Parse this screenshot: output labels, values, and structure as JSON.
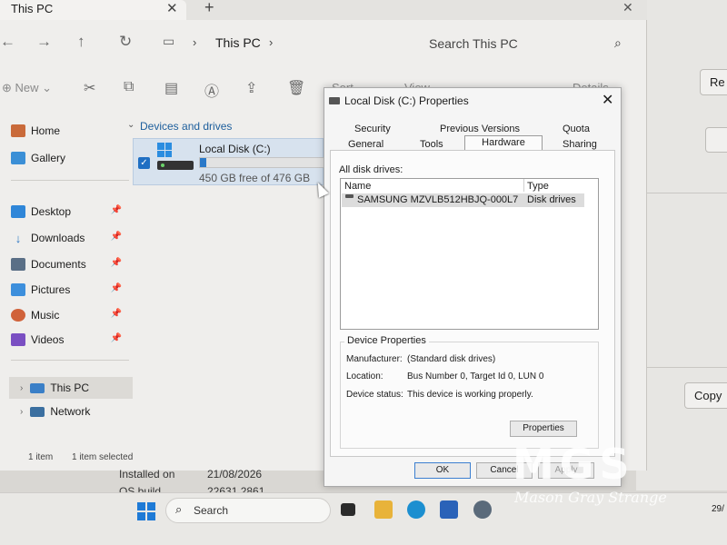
{
  "explorer": {
    "tab_title": "This PC",
    "breadcrumb": "This PC",
    "search_placeholder": "Search This PC",
    "toolbar": {
      "new_label": "New",
      "sort_label": "Sort",
      "view_label": "View",
      "details_label": "Details"
    },
    "sidebar": {
      "home": "Home",
      "gallery": "Gallery",
      "pinned": [
        {
          "label": "Desktop"
        },
        {
          "label": "Downloads"
        },
        {
          "label": "Documents"
        },
        {
          "label": "Pictures"
        },
        {
          "label": "Music"
        },
        {
          "label": "Videos"
        }
      ],
      "this_pc": "This PC",
      "network": "Network"
    },
    "content": {
      "group_header": "Devices and drives",
      "drive_name": "Local Disk (C:)",
      "drive_free": "450 GB free of 476 GB",
      "drive_used_fraction": 0.055
    },
    "status": {
      "item_count": "1 item",
      "selected": "1 item selected"
    },
    "behind_text": {
      "installed_on_label": "Installed on",
      "installed_on_value": "21/08/2026",
      "os_build_label": "OS build",
      "os_build_value": "22631.2861"
    }
  },
  "background_window": {
    "btn_top": "Re",
    "btn_copy": "Copy"
  },
  "dialog": {
    "title": "Local Disk (C:) Properties",
    "tabs_row1": {
      "security": "Security",
      "previous_versions": "Previous Versions",
      "quota": "Quota"
    },
    "tabs_row2": {
      "general": "General",
      "tools": "Tools",
      "hardware": "Hardware",
      "sharing": "Sharing"
    },
    "all_disk_drives_label": "All disk drives:",
    "columns": {
      "name": "Name",
      "type": "Type"
    },
    "drive_row": {
      "name": "SAMSUNG MZVLB512HBJQ-000L7",
      "type": "Disk drives"
    },
    "device_properties": {
      "group_label": "Device Properties",
      "manufacturer_label": "Manufacturer:",
      "manufacturer_value": "(Standard disk drives)",
      "location_label": "Location:",
      "location_value": "Bus Number 0, Target Id 0, LUN 0",
      "status_label": "Device status:",
      "status_value": "This device is working properly.",
      "properties_button": "Properties"
    },
    "buttons": {
      "ok": "OK",
      "cancel": "Cancel",
      "apply": "Apply"
    }
  },
  "taskbar": {
    "search_label": "Search",
    "clock": "29/"
  },
  "colors": {
    "accent": "#1f6fc3",
    "selection_bg": "#d7e2ee",
    "link_blue": "#1d5e9c"
  },
  "icons": [
    "back-arrow-icon",
    "forward-arrow-icon",
    "up-arrow-icon",
    "refresh-icon",
    "monitor-icon",
    "search-icon",
    "cut-icon",
    "copy-icon",
    "paste-icon",
    "rename-icon",
    "share-icon",
    "delete-icon",
    "home-icon",
    "gallery-icon",
    "pin-icon",
    "disk-icon",
    "windows-logo-icon"
  ],
  "watermark": {
    "logo": "MGS",
    "text": "Mason Gray Strange"
  }
}
